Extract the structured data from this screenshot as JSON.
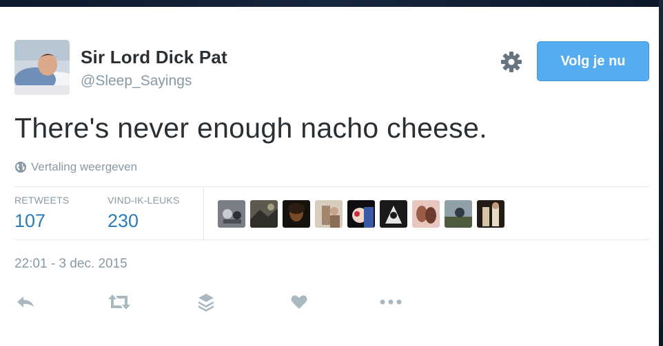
{
  "profile": {
    "name": "Sir Lord Dick Pat",
    "handle": "@Sleep_Sayings",
    "avatar_icon": "sleeping-man-avatar"
  },
  "header": {
    "settings_icon": "gear-icon",
    "follow_label": "Volg je nu",
    "follow_color": "#55acee"
  },
  "tweet": {
    "text": "There's never enough nacho cheese.",
    "translate_icon": "globe-icon",
    "translate_label": "Vertaling weergeven"
  },
  "stats": {
    "retweets_label": "RETWEETS",
    "retweets_value": "107",
    "likes_label": "VIND-IK-LEUKS",
    "likes_value": "230",
    "value_color": "#2b7bb9"
  },
  "likers_count_shown": 9,
  "timestamp": "22:01 - 3 dec. 2015",
  "actions": [
    {
      "name": "reply",
      "icon": "reply-icon"
    },
    {
      "name": "retweet",
      "icon": "retweet-icon"
    },
    {
      "name": "stack",
      "icon": "layers-icon"
    },
    {
      "name": "like",
      "icon": "heart-icon"
    },
    {
      "name": "more",
      "icon": "more-dots-icon"
    }
  ]
}
